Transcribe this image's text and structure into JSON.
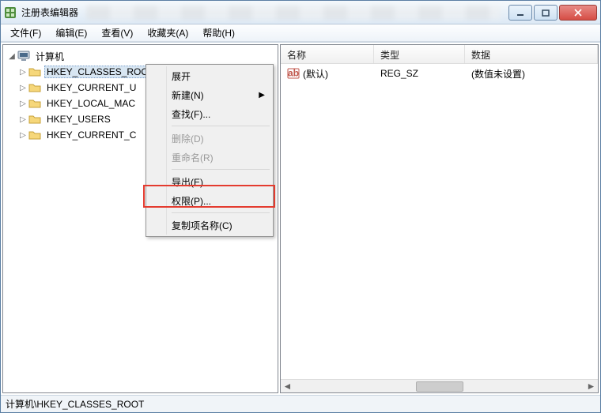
{
  "window": {
    "title": "注册表编辑器"
  },
  "menubar": {
    "items": [
      {
        "label": "文件(F)"
      },
      {
        "label": "编辑(E)"
      },
      {
        "label": "查看(V)"
      },
      {
        "label": "收藏夹(A)"
      },
      {
        "label": "帮助(H)"
      }
    ]
  },
  "tree": {
    "root_label": "计算机",
    "nodes": [
      {
        "label": "HKEY_CLASSES_ROOT",
        "selected": true
      },
      {
        "label": "HKEY_CURRENT_U"
      },
      {
        "label": "HKEY_LOCAL_MAC"
      },
      {
        "label": "HKEY_USERS"
      },
      {
        "label": "HKEY_CURRENT_C"
      }
    ]
  },
  "list": {
    "columns": {
      "name": "名称",
      "type": "类型",
      "data": "数据"
    },
    "rows": [
      {
        "name": "(默认)",
        "type": "REG_SZ",
        "data": "(数值未设置)"
      }
    ]
  },
  "context_menu": {
    "items": [
      {
        "label": "展开",
        "type": "item"
      },
      {
        "label": "新建(N)",
        "type": "submenu"
      },
      {
        "label": "查找(F)...",
        "type": "item"
      },
      {
        "type": "separator"
      },
      {
        "label": "删除(D)",
        "type": "item",
        "disabled": true
      },
      {
        "label": "重命名(R)",
        "type": "item",
        "disabled": true
      },
      {
        "type": "separator"
      },
      {
        "label": "导出(E)",
        "type": "item"
      },
      {
        "label": "权限(P)...",
        "type": "item",
        "highlight": true
      },
      {
        "type": "separator"
      },
      {
        "label": "复制项名称(C)",
        "type": "item"
      }
    ]
  },
  "statusbar": {
    "path": "计算机\\HKEY_CLASSES_ROOT"
  },
  "icons": {
    "expander_closed": "▷",
    "expander_open": "◢",
    "submenu_arrow": "▶"
  }
}
